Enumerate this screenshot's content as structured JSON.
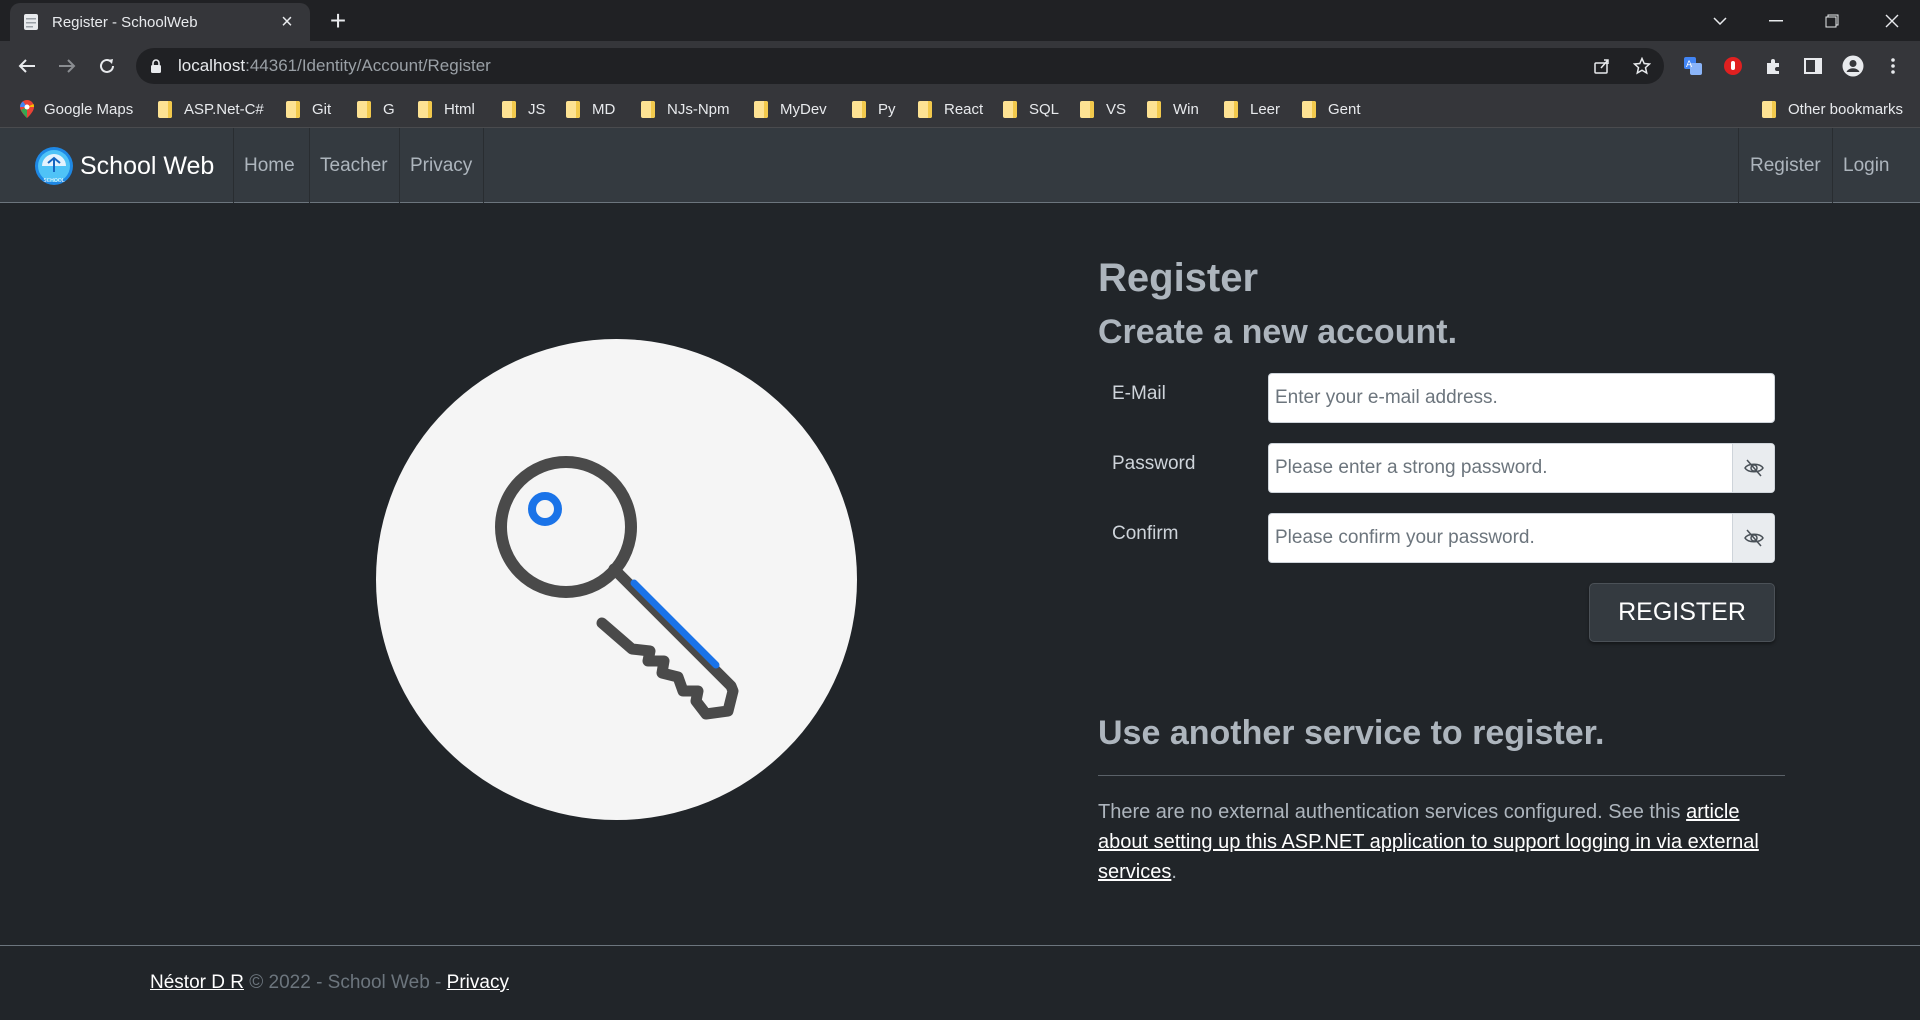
{
  "browser": {
    "tab_title": "Register - SchoolWeb",
    "url_host": "localhost",
    "url_rest": ":44361/Identity/Account/Register",
    "bookmarks": [
      "Google Maps",
      "ASP.Net-C#",
      "Git",
      "G",
      "Html",
      "JS",
      "MD",
      "NJs-Npm",
      "MyDev",
      "Py",
      "React",
      "SQL",
      "VS",
      "Win",
      "Leer",
      "Gent"
    ],
    "other_bookmarks": "Other bookmarks"
  },
  "nav": {
    "brand": "School Web",
    "logo_text": "SCHOOL",
    "links": [
      "Home",
      "Teacher",
      "Privacy"
    ],
    "right_links": [
      "Register",
      "Login"
    ]
  },
  "form": {
    "title": "Register",
    "subtitle": "Create a new account.",
    "email_label": "E-Mail",
    "email_placeholder": "Enter your e-mail address.",
    "password_label": "Password",
    "password_placeholder": "Please enter a strong password.",
    "confirm_label": "Confirm",
    "confirm_placeholder": "Please confirm your password.",
    "submit": "REGISTER"
  },
  "external": {
    "title": "Use another service to register.",
    "text": "There are no external authentication services configured. See this ",
    "link": "article about setting up this ASP.NET application to support logging in via external services",
    "end": "."
  },
  "footer": {
    "author": "Néstor D R",
    "copyright": " © 2022 - School Web - ",
    "privacy": "Privacy"
  },
  "colors": {
    "background": "#212529",
    "navbar": "#343a40",
    "key_accent": "#1a73e8",
    "key_outline": "#4a4a4a"
  }
}
